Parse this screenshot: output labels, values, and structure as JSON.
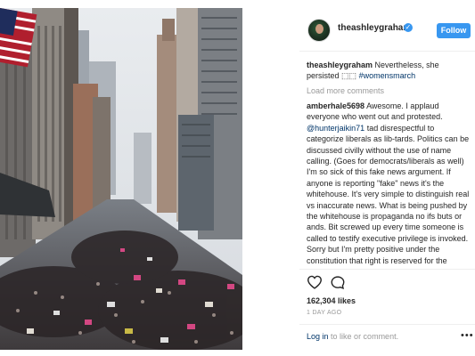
{
  "post": {
    "username": "theashleygraham",
    "follow_label": "Follow",
    "caption_user": "theashleygraham",
    "caption_text": "Nevertheless, she persisted",
    "caption_hashtag": "#womensmarch",
    "load_more": "Load more comments",
    "comment": {
      "user": "amberhale5698",
      "text_1": "Awesome. I applaud everyone who went out and protested.",
      "mention": "@hunterjaikin71",
      "text_2": "tad disrespectful to categorize liberals as lib-tards. Politics can be discussed civilly without the use of name calling. (Goes for democrats/liberals as well) I'm so sick of this fake news argument. If anyone is reporting \"fake\" news it's the whitehouse. It's very simple to distinguish real vs inaccurate news. What is being pushed by the whitehouse is propaganda no ifs buts or ands. Bit screwed up every time someone is called to testify executive privilege is invoked. Sorry but I'm pretty positive under the constitution that right is reserved for the president not his staff. That is what we call"
    },
    "likes": "162,304 likes",
    "time": "1 DAY AGO",
    "login_link": "Log in",
    "login_text": "to like or comment.",
    "more_label": "•••"
  },
  "icons": {
    "verified": "verified-badge",
    "like": "heart-icon",
    "comment": "comment-icon"
  },
  "colors": {
    "accent": "#3897f0",
    "link": "#003569",
    "muted": "#999999"
  }
}
